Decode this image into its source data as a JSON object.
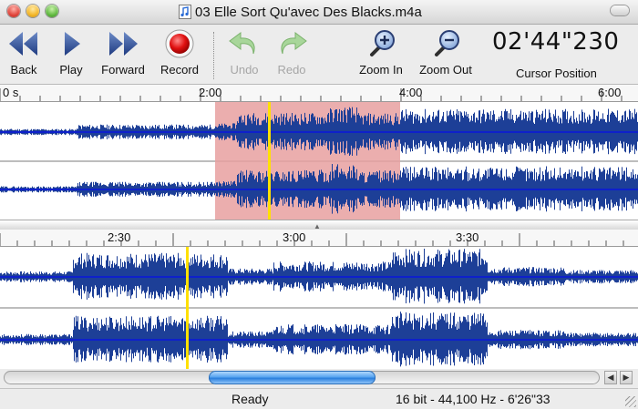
{
  "window": {
    "title": "03 Elle Sort Qu'avec Des Blacks.m4a",
    "controls": [
      "close",
      "minimize",
      "zoom"
    ]
  },
  "toolbar": {
    "back_label": "Back",
    "play_label": "Play",
    "forward_label": "Forward",
    "record_label": "Record",
    "undo_label": "Undo",
    "redo_label": "Redo",
    "zoom_in_label": "Zoom In",
    "zoom_out_label": "Zoom Out",
    "cursor_time": "02'44\"230",
    "cursor_label": "Cursor Position",
    "undo_enabled": false,
    "redo_enabled": false
  },
  "overview": {
    "ruler": {
      "labels": [
        "0 s",
        "2:00",
        "4:00",
        "6:00"
      ]
    },
    "selection_start_s": 124,
    "selection_end_s": 236,
    "cursor_s": 164
  },
  "detail": {
    "ruler": {
      "labels": [
        "2:30",
        "3:00",
        "3:30"
      ]
    },
    "cursor_s": 164
  },
  "scrollbar": {
    "left_arrow": "◀",
    "right_arrow": "▶"
  },
  "status": {
    "state": "Ready",
    "format": "16 bit - 44,100 Hz - 6'26\"33"
  },
  "colors": {
    "waveform": "#1d3f97",
    "waveform_bg": "#ffffff",
    "baseline": "#0000ff",
    "selection": "#e8a0a0",
    "cursor": "#ffe000",
    "record": "#e01010"
  }
}
